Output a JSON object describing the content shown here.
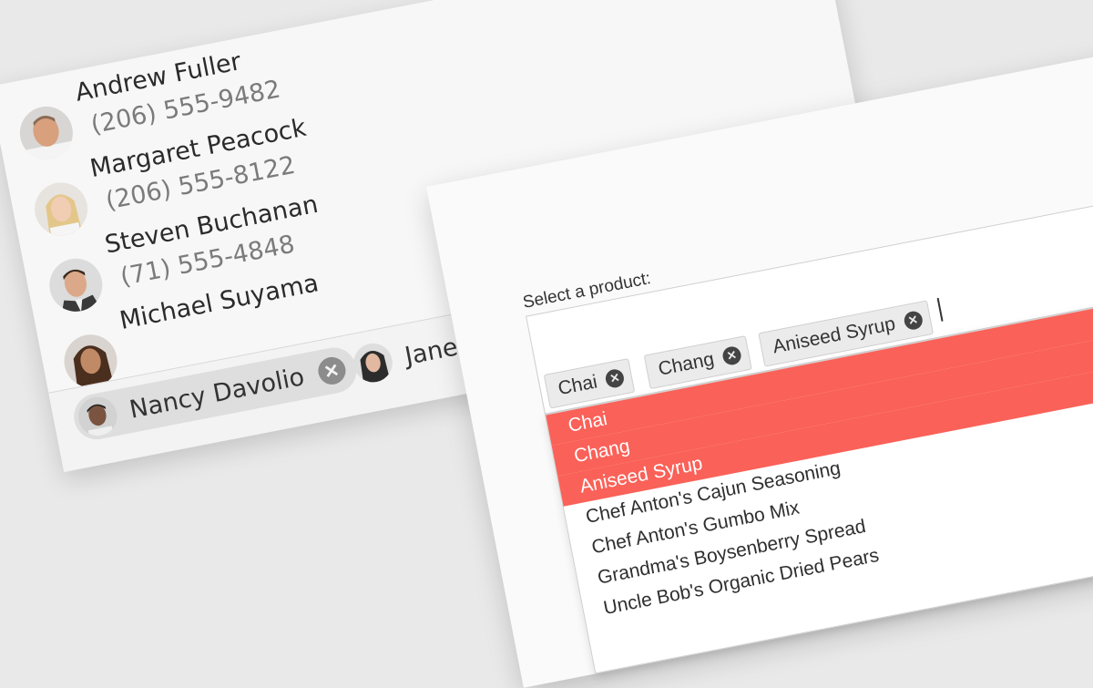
{
  "contacts": [
    {
      "name": "Andrew Fuller",
      "phone": "(206) 555-9482"
    },
    {
      "name": "Margaret Peacock",
      "phone": "(206) 555-8122"
    },
    {
      "name": "Steven Buchanan",
      "phone": "(71) 555-4848"
    },
    {
      "name": "Michael Suyama",
      "phone": ""
    }
  ],
  "contact_chips": [
    {
      "name": "Nancy Davolio",
      "remove_icon": "close-circle-icon"
    },
    {
      "name": "Jane"
    }
  ],
  "product_select": {
    "label": "Select a product:",
    "clear_icon": "×",
    "chips": [
      {
        "label": "Chai"
      },
      {
        "label": "Chang"
      },
      {
        "label": "Aniseed Syrup"
      }
    ],
    "options": [
      {
        "label": "Chai",
        "selected": true
      },
      {
        "label": "Chang",
        "selected": true
      },
      {
        "label": "Aniseed Syrup",
        "selected": true
      },
      {
        "label": "Chef Anton's Cajun Seasoning",
        "selected": false
      },
      {
        "label": "Chef Anton's Gumbo Mix",
        "selected": false
      },
      {
        "label": "Grandma's Boysenberry Spread",
        "selected": false
      },
      {
        "label": "Uncle Bob's Organic Dried Pears",
        "selected": false
      }
    ]
  },
  "colors": {
    "selection": "#fa6158",
    "chip_bg": "#ebebeb",
    "background": "#e9e9e9"
  }
}
